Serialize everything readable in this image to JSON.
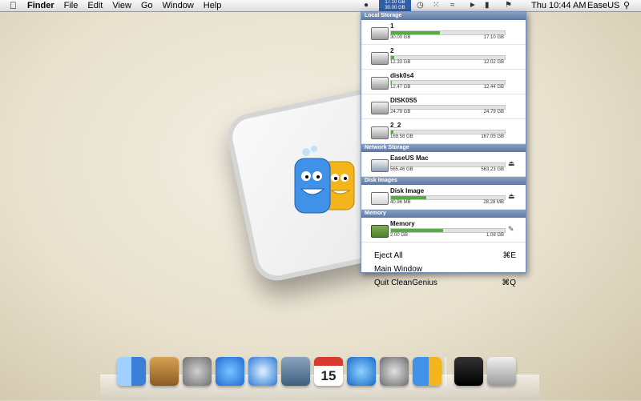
{
  "menubar": {
    "app_name": "Finder",
    "menus": [
      "File",
      "Edit",
      "View",
      "Go",
      "Window",
      "Help"
    ],
    "widget_line1": "17.10 GB",
    "widget_line2": "30.00 GB",
    "clock": "Thu 10:44 AM",
    "user": "EaseUS"
  },
  "panel": {
    "sections": [
      {
        "title": "Local Storage",
        "items": [
          {
            "name": "1",
            "used": "30.00 GB",
            "free": "17.10 GB",
            "fill": 0.43
          },
          {
            "name": "2",
            "used": "12.33 GB",
            "free": "12.02 GB",
            "fill": 0.03
          },
          {
            "name": "disk0s4",
            "used": "12.47 GB",
            "free": "12.44 GB",
            "fill": 0.01
          },
          {
            "name": "DISK0S5",
            "used": "24.79 GB",
            "free": "24.79 GB",
            "fill": 0.0
          },
          {
            "name": "2_2",
            "used": "169.58 GB",
            "free": "167.05 GB",
            "fill": 0.02
          }
        ]
      },
      {
        "title": "Network Storage",
        "items": [
          {
            "name": "EaseUS Mac",
            "used": "565.46 GB",
            "free": "563.23 GB",
            "fill": 0.0
          }
        ]
      },
      {
        "title": "Disk Images",
        "items": [
          {
            "name": "Disk Image",
            "used": "40.96 MB",
            "free": "28.28 MB",
            "fill": 0.31
          }
        ]
      },
      {
        "title": "Memory",
        "items": [
          {
            "name": "Memory",
            "used": "2.00 GB",
            "free": "1.08 GB",
            "fill": 0.46
          }
        ]
      }
    ],
    "commands": [
      {
        "label": "Eject All",
        "key": "⌘E"
      },
      {
        "label": "Main Window",
        "key": ""
      },
      {
        "label": "Quit CleanGenius",
        "key": "⌘Q"
      }
    ]
  },
  "dock": {
    "icons": [
      "finder-icon",
      "address-book-icon",
      "launchpad-icon",
      "app-store-icon",
      "safari-icon",
      "facetime-icon",
      "calendar-icon",
      "itunes-icon",
      "system-preferences-icon",
      "cleangenius-icon",
      "activity-monitor-icon",
      "trash-icon"
    ],
    "calendar_day": "15"
  }
}
